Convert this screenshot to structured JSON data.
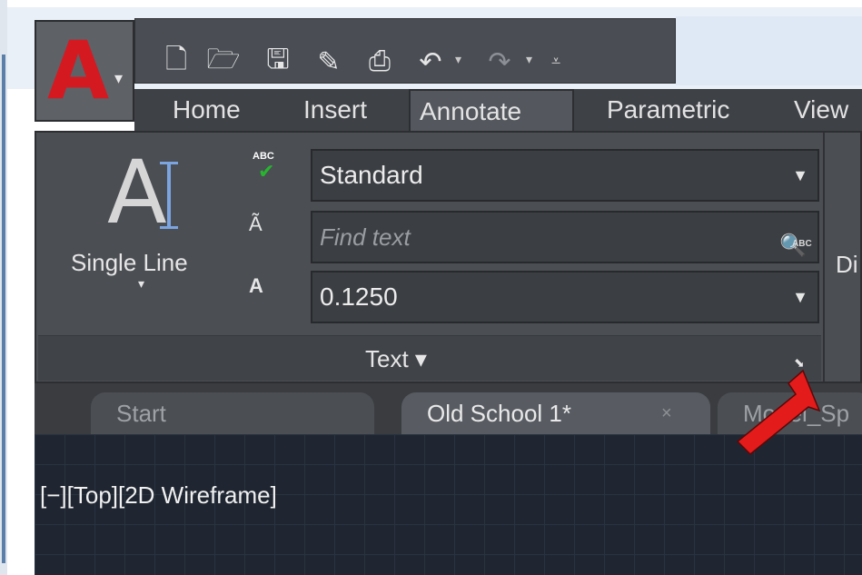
{
  "app": {
    "logo_letter": "A",
    "logo_color": "#d51921"
  },
  "quick_access": {
    "icons": [
      "new-icon",
      "open-icon",
      "save-icon",
      "save-as-icon",
      "print-icon",
      "undo-icon",
      "redo-icon",
      "customize-icon"
    ]
  },
  "ribbon_tabs": [
    {
      "label": "Home"
    },
    {
      "label": "Insert"
    },
    {
      "label": "Annotate",
      "active": true
    },
    {
      "label": "Parametric"
    },
    {
      "label": "View"
    }
  ],
  "text_panel": {
    "big_button_label": "Single Line",
    "text_style_value": "Standard",
    "find_placeholder": "Find text",
    "text_height_value": "0.1250",
    "panel_title": "Text",
    "abc_badge": "ABC",
    "find_badge": "ABC",
    "next_panel_partial": "Di"
  },
  "doc_tabs": [
    {
      "label": "Start"
    },
    {
      "label": "Old School 1*",
      "active": true,
      "close": "×"
    },
    {
      "label": "Model_Sp"
    }
  ],
  "viewport": {
    "label": "[−][Top][2D Wireframe]"
  },
  "annotation_arrow": {
    "color": "#e31b1b"
  }
}
